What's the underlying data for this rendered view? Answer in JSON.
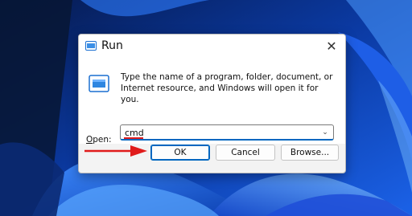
{
  "dialog": {
    "title": "Run",
    "close_glyph": "✕",
    "description": "Type the name of a program, folder, document, or Internet resource, and Windows will open it for you.",
    "open_label_prefix": "",
    "open_label_underlined": "O",
    "open_label_rest": "pen:",
    "input_value": "cmd",
    "dropdown_glyph": "⌄"
  },
  "buttons": {
    "ok": "OK",
    "cancel": "Cancel",
    "browse": "Browse..."
  },
  "icons": {
    "title": "run-app-icon",
    "body": "run-app-icon",
    "close": "close-icon",
    "dropdown": "chevron-down-icon",
    "annotation": "red-arrow-icon"
  },
  "colors": {
    "accent": "#0067c0",
    "annotation": "#e01b1b",
    "wallpaper": "#0a2f86"
  }
}
